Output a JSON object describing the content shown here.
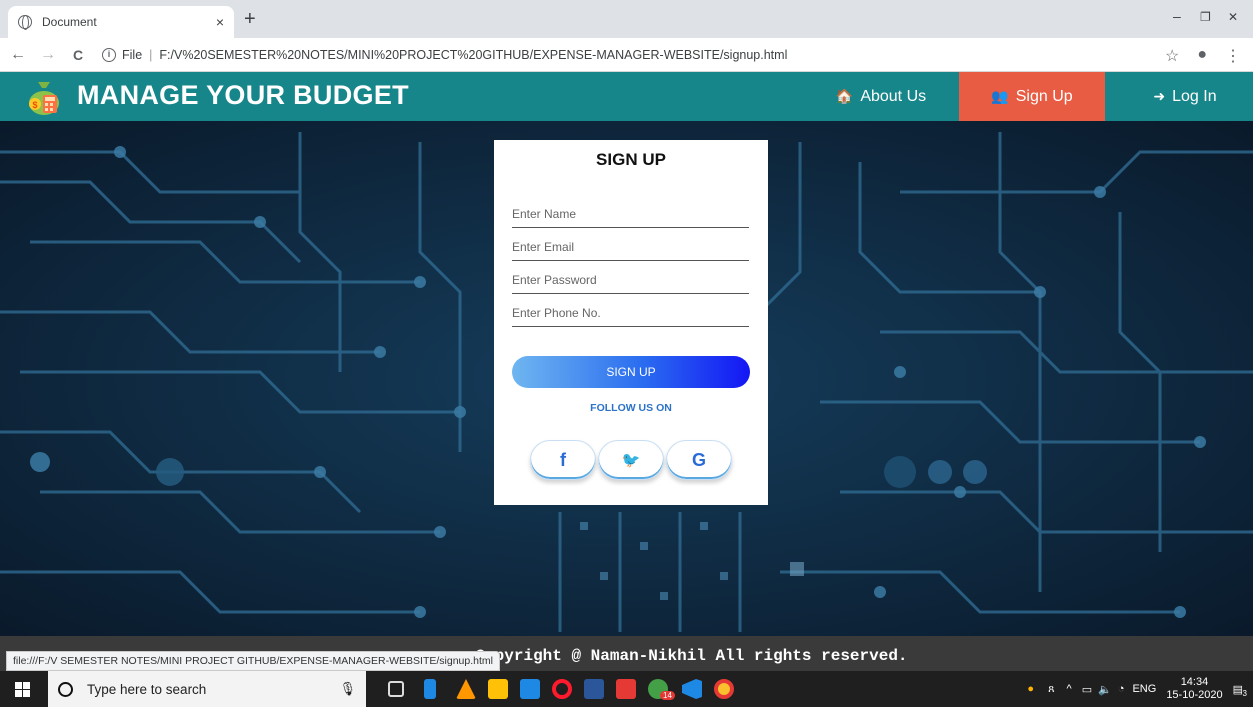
{
  "browser": {
    "tab_title": "Document",
    "tab_close": "×",
    "new_tab": "+",
    "window_controls": [
      "–",
      "❐",
      "✕"
    ],
    "nav_back": "←",
    "nav_forward": "→",
    "nav_reload": "C",
    "url_scheme_label": "File",
    "url": "F:/V%20SEMESTER%20NOTES/MINI%20PROJECT%20GITHUB/EXPENSE-MANAGER-WEBSITE/signup.html",
    "status_url": "file:///F:/V SEMESTER NOTES/MINI PROJECT GITHUB/EXPENSE-MANAGER-WEBSITE/signup.html"
  },
  "navbar": {
    "brand": "MANAGE YOUR BUDGET",
    "links": [
      {
        "label": "About Us",
        "icon": "home-icon",
        "glyph": "🏠"
      },
      {
        "label": "Sign Up",
        "icon": "user-plus-icon",
        "glyph": "👥"
      },
      {
        "label": "Log In",
        "icon": "sign-in-icon",
        "glyph": "➜"
      }
    ],
    "active_color": "#e85c43",
    "bar_color": "#17868a"
  },
  "form": {
    "heading": "SIGN UP",
    "fields": [
      {
        "placeholder": "Enter Name"
      },
      {
        "placeholder": "Enter Email"
      },
      {
        "placeholder": "Enter Password"
      },
      {
        "placeholder": "Enter Phone No."
      }
    ],
    "submit_label": "SIGN UP",
    "follow_label": "FOLLOW US ON",
    "social": [
      {
        "icon": "facebook-icon",
        "glyph": "f"
      },
      {
        "icon": "twitter-icon",
        "glyph": "🐦"
      },
      {
        "icon": "google-icon",
        "glyph": "G"
      }
    ]
  },
  "footer": {
    "text": "Copyright @ Naman-Nikhil All rights reserved."
  },
  "taskbar": {
    "search_placeholder": "Type here to search",
    "language": "ENG",
    "time": "14:34",
    "date": "15-10-2020",
    "notification_count": "3",
    "whatsapp_badge": "14"
  }
}
